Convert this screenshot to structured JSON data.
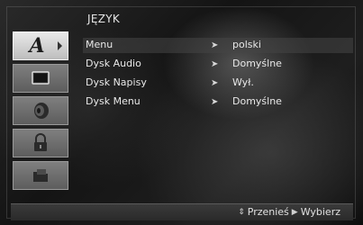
{
  "window": {
    "title": "JĘZYK"
  },
  "sidebar": {
    "items": [
      {
        "name": "language",
        "icon": "letter-a-icon",
        "active": true
      },
      {
        "name": "display",
        "icon": "tv-screen-icon",
        "active": false
      },
      {
        "name": "audio",
        "icon": "speaker-icon",
        "active": false
      },
      {
        "name": "lock",
        "icon": "padlock-icon",
        "active": false
      },
      {
        "name": "others",
        "icon": "folder-icon",
        "active": false
      }
    ]
  },
  "menu": {
    "rows": [
      {
        "label": "Menu",
        "value": "polski"
      },
      {
        "label": "Dysk Audio",
        "value": "Domyślne"
      },
      {
        "label": "Dysk Napisy",
        "value": "Wył."
      },
      {
        "label": "Dysk Menu",
        "value": "Domyślne"
      }
    ]
  },
  "footer": {
    "move_symbol": "⇕",
    "move_label": "Przenieś",
    "select_symbol": "▶",
    "select_label": "Wybierz"
  },
  "colors": {
    "active_tab": "#d8d8d8",
    "inactive_tab": "#6e6e6e",
    "text": "#e8e8e8"
  }
}
